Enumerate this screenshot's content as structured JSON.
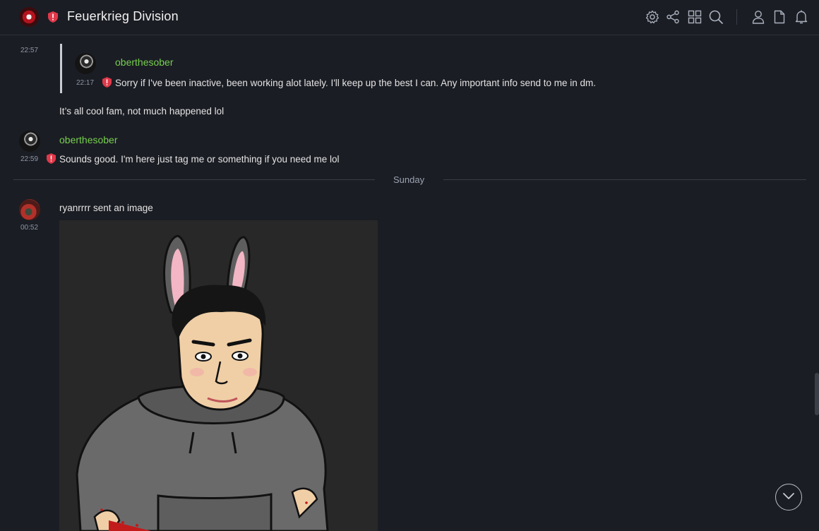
{
  "header": {
    "room_name": "Feuerkrieg Division",
    "icons": [
      "settings-icon",
      "share-icon",
      "apps-icon",
      "search-icon",
      "member-icon",
      "files-icon",
      "notifications-icon"
    ]
  },
  "timeline": {
    "msg1": {
      "time": "22:57",
      "reply": {
        "sender": "oberthesober",
        "time": "22:17",
        "text": "Sorry if I've been inactive, been working alot lately. I'll keep up the best I can. Any important info send to me in dm."
      },
      "text": "It’s all cool fam, not much happened lol"
    },
    "msg2": {
      "sender": "oberthesober",
      "time": "22:59",
      "text": "Sounds good. I'm here just tag me or something if you need me lol"
    },
    "day_separator": "Sunday",
    "msg3": {
      "time": "00:52",
      "text": "ryanrrrr sent an image"
    }
  },
  "colors": {
    "background": "#1b1d24",
    "sender_green": "#76cf4f",
    "shield_red": "#e0394a"
  }
}
